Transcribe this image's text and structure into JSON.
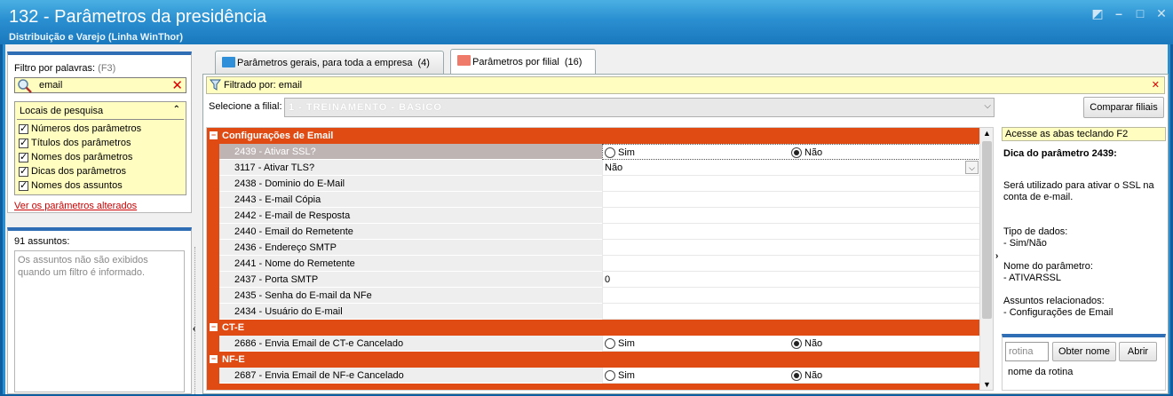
{
  "window": {
    "title": "132 - Parâmetros da presidência",
    "subtitle": "Distribuição e Varejo (Linha WinThor)"
  },
  "left": {
    "filter_label": "Filtro por palavras:",
    "filter_shortcut": "(F3)",
    "search_value": "email",
    "locais_title": "Locais de pesquisa",
    "checks": [
      "Números dos parâmetros",
      "Títulos dos parâmetros",
      "Nomes dos parâmetros",
      "Dicas dos parâmetros",
      "Nomes dos assuntos"
    ],
    "changed_link": "Ver os parâmetros alterados",
    "assuntos_count": "91 assuntos:",
    "assuntos_note": "Os assuntos não são exibidos quando um filtro é informado."
  },
  "tabs": [
    {
      "label": "Parâmetros gerais, para toda a empresa",
      "count": "(4)",
      "color": "#2f8fd8"
    },
    {
      "label": "Parâmetros por filial",
      "count": "(16)",
      "color": "#f07a6a"
    }
  ],
  "filterbar": {
    "text": "Filtrado por: email"
  },
  "filial": {
    "label": "Selecione a filial:",
    "value": "1 - TREINAMENTO - BASICO"
  },
  "compare_button": "Comparar filiais",
  "grid": {
    "groups": [
      {
        "title": "Configurações de Email"
      },
      {
        "title": "CT-E"
      },
      {
        "title": "NF-E"
      }
    ],
    "rows": [
      {
        "name": "2439 - Ativar SSL?",
        "yes": "Sim",
        "no": "Não"
      },
      {
        "name": "3117 - Ativar TLS?",
        "value": "Não"
      },
      {
        "name": "2438 - Dominio do E-Mail",
        "value": ""
      },
      {
        "name": "2443 - E-mail Cópia",
        "value": ""
      },
      {
        "name": "2442 - E-mail de Resposta",
        "value": ""
      },
      {
        "name": "2440 - Email do Remetente",
        "value": ""
      },
      {
        "name": "2436 - Endereço SMTP",
        "value": ""
      },
      {
        "name": "2441 - Nome do Remetente",
        "value": ""
      },
      {
        "name": "2437 - Porta SMTP",
        "value": "0"
      },
      {
        "name": "2435 - Senha do E-mail da NFe",
        "value": ""
      },
      {
        "name": "2434 - Usuário do E-mail",
        "value": ""
      },
      {
        "name": "2686 - Envia Email de CT-e Cancelado",
        "yes": "Sim",
        "no": "Não"
      },
      {
        "name": "2687 - Envia Email de NF-e Cancelado",
        "yes": "Sim",
        "no": "Não"
      }
    ]
  },
  "right": {
    "hint": "Acesse as abas teclando F2",
    "title": "Dica do parâmetro 2439:",
    "desc": "Será utilizado para ativar o SSL na conta de e-mail.",
    "tipo_label": "Tipo de dados:",
    "tipo_value": "- Sim/Não",
    "nome_label": "Nome do parâmetro:",
    "nome_value": "- ATIVARSSL",
    "assuntos_label": "Assuntos relacionados:",
    "assuntos_value": "- Configurações de Email",
    "rotina_placeholder": "rotina",
    "obter_button": "Obter nome",
    "abrir_button": "Abrir",
    "rotina_note": "nome da rotina"
  }
}
